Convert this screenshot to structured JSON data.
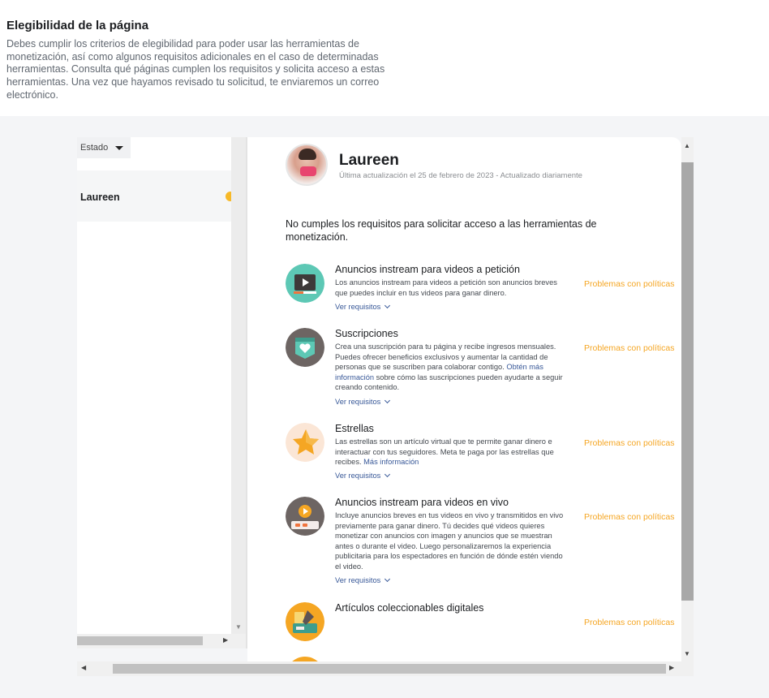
{
  "header": {
    "title": "Elegibilidad de la página",
    "description": "Debes cumplir los criterios de elegibilidad para poder usar las herramientas de monetización, así como algunos requisitos adicionales en el caso de determinadas herramientas. Consulta qué páginas cumplen los requisitos y solicita acceso a estas herramientas. Una vez que hayamos revisado tu solicitud, te enviaremos un correo electrónico."
  },
  "left_panel": {
    "filter_label": "Estado",
    "pages": [
      {
        "name": "Laureen"
      }
    ]
  },
  "profile": {
    "name": "Laureen",
    "updated": "Última actualización el 25 de febrero de 2023 - Actualizado diariamente"
  },
  "notice": "No cumples los requisitos para solicitar acceso a las herramientas de monetización.",
  "tools": [
    {
      "title": "Anuncios instream para videos a petición",
      "description": "Los anuncios instream para videos a petición son anuncios breves que puedes incluir en tus videos para ganar dinero.",
      "requirements_label": "Ver requisitos",
      "status": "Problemas con políticas",
      "icon": "video-player-icon"
    },
    {
      "title": "Suscripciones",
      "description": "Crea una suscripción para tu página y recibe ingresos mensuales. Puedes ofrecer beneficios exclusivos y aumentar la cantidad de personas que se suscriben para colaborar contigo.",
      "link_text": "Obtén más información",
      "description_after": "sobre cómo las suscripciones pueden ayudarte a seguir creando contenido.",
      "requirements_label": "Ver requisitos",
      "status": "Problemas con políticas",
      "icon": "heart-badge-icon"
    },
    {
      "title": "Estrellas",
      "description": "Las estrellas son un artículo virtual que te permite ganar dinero e interactuar con tus seguidores. Meta te paga por las estrellas que recibes.",
      "link_text": "Más información",
      "requirements_label": "Ver requisitos",
      "status": "Problemas con políticas",
      "icon": "star-icon"
    },
    {
      "title": "Anuncios instream para videos en vivo",
      "description": "Incluye anuncios breves en tus videos en vivo y transmitidos en vivo previamente para ganar dinero. Tú decides qué videos quieres monetizar con anuncios con imagen y anuncios que se muestran antes o durante el video. Luego personalizaremos la experiencia publicitaria para los espectadores en función de dónde estén viendo el video.",
      "requirements_label": "Ver requisitos",
      "status": "Problemas con políticas",
      "icon": "live-video-icon"
    },
    {
      "title": "Artículos coleccionables digitales",
      "status": "Problemas con políticas",
      "icon": "collectibles-icon"
    }
  ],
  "colors": {
    "status": "#f5a623",
    "link": "#385898",
    "pending_dot": "#f7b928"
  }
}
